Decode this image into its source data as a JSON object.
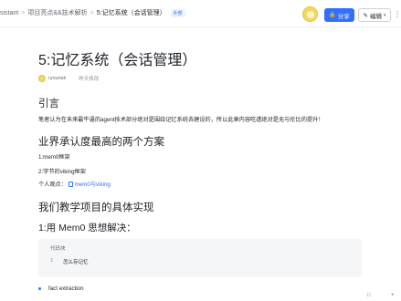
{
  "breadcrumb": {
    "items": [
      "sistant",
      "项目亮点&&技术解析",
      "5:记忆系统（会话管理）"
    ],
    "badge": "外部"
  },
  "toolbar": {
    "share_label": "分享",
    "edit_label": "编辑",
    "share_icon": "lock-icon",
    "edit_icon": "pencil-icon"
  },
  "document": {
    "title": "5:记忆系统（会话管理）",
    "author": "ryounsk",
    "modified": "昨天修改",
    "sections": {
      "intro_heading": "引言",
      "intro_text": "笔者认为在未来最牛逼的agent技术部分绝对是围绕记忆系统去建设的，所以此章内容吃透绝对是无与伦比的提升！",
      "schemes_heading": "业界承认度最高的两个方案",
      "scheme_1": "1:mem0框架",
      "scheme_2": "2:字节的viking框架",
      "opinion_label": "个人观点：",
      "opinion_link": "mem0与viking",
      "impl_heading": "我们教学项目的具体实现",
      "mem0_heading": "1:用 Mem0 思想解决：",
      "code_lang": "代码块",
      "code_line_no": "1",
      "code_line": "怎么存记忆",
      "bullet_1": "fact extraction"
    }
  },
  "colors": {
    "accent": "#3370ff",
    "text": "#1f2329",
    "muted": "#646a73",
    "code_bg": "#f5f6f7"
  }
}
